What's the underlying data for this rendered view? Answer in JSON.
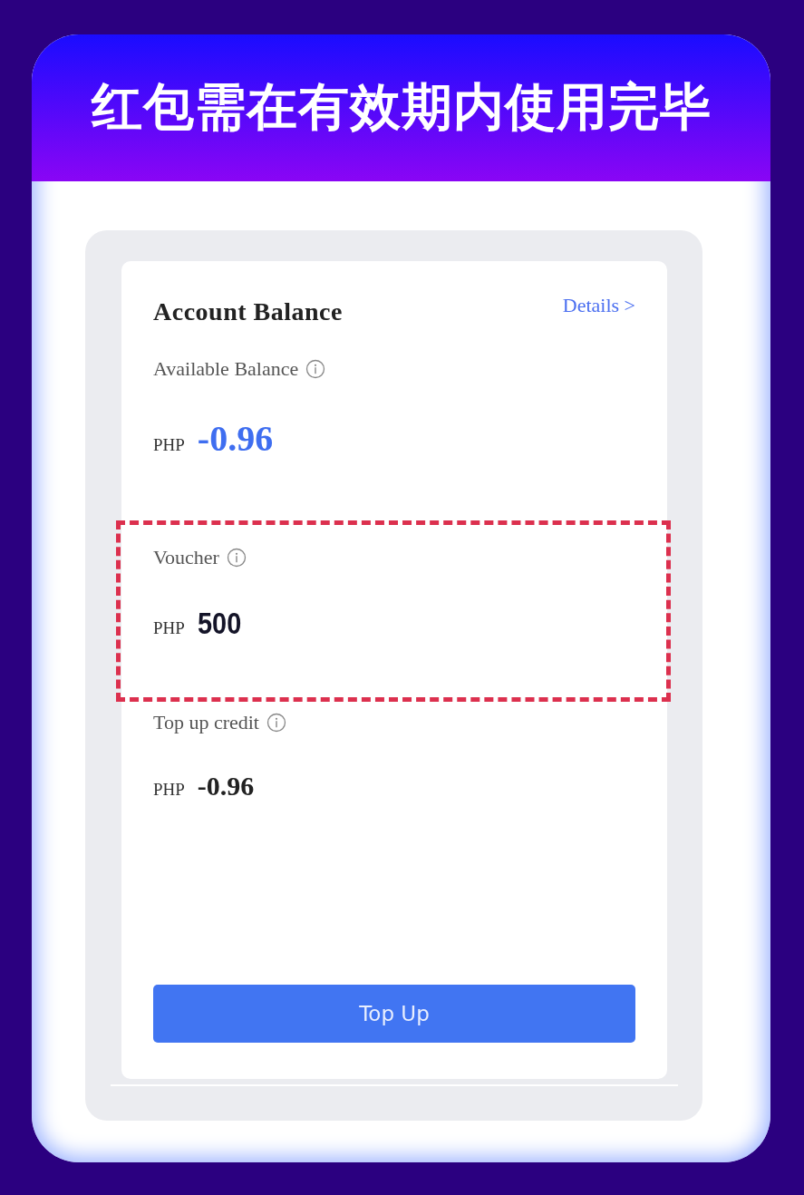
{
  "banner": {
    "title": "红包需在有效期内使用完毕"
  },
  "card": {
    "title": "Account Balance",
    "details_link": "Details >",
    "sections": [
      {
        "label": "Available Balance",
        "currency": "PHP",
        "amount": "-0.96",
        "kind": "accent",
        "highlighted": false
      },
      {
        "label": "Voucher",
        "currency": "PHP",
        "amount": "500",
        "kind": "display",
        "highlighted": true
      },
      {
        "label": "Top up credit",
        "currency": "PHP",
        "amount": "-0.96",
        "kind": "plain",
        "highlighted": false
      }
    ],
    "button": "Top Up"
  }
}
